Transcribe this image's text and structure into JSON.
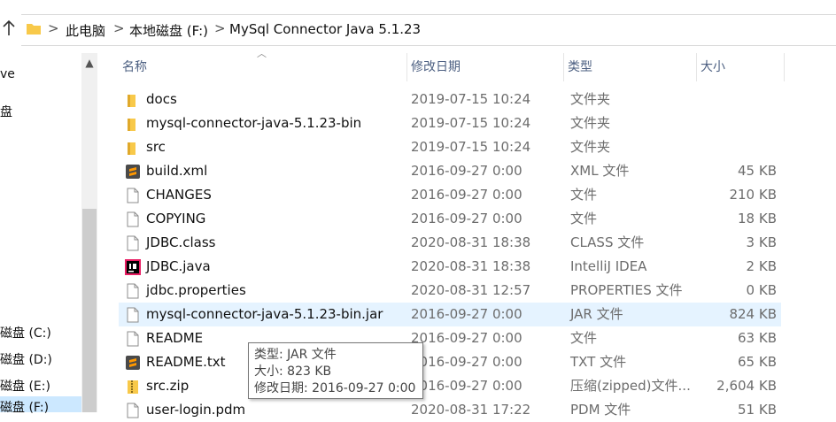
{
  "address_bar": {
    "breadcrumbs": [
      "此电脑",
      "本地磁盘 (F:)",
      "MySql Connector Java 5.1.23"
    ],
    "separator": ">"
  },
  "nav_pane": {
    "items": [
      "ve",
      "盘",
      "磁盘 (C:)",
      "磁盘 (D:)",
      "磁盘 (E:)",
      "磁盘 (F:)"
    ]
  },
  "columns": {
    "name": "名称",
    "date": "修改日期",
    "type": "类型",
    "size": "大小"
  },
  "files": [
    {
      "name": "docs",
      "date": "2019-07-15 10:24",
      "type": "文件夹",
      "size": "",
      "icon": "folder-icon"
    },
    {
      "name": "mysql-connector-java-5.1.23-bin",
      "date": "2019-07-15 10:24",
      "type": "文件夹",
      "size": "",
      "icon": "folder-icon"
    },
    {
      "name": "src",
      "date": "2019-07-15 10:24",
      "type": "文件夹",
      "size": "",
      "icon": "folder-icon"
    },
    {
      "name": "build.xml",
      "date": "2016-09-27 0:00",
      "type": "XML 文件",
      "size": "45 KB",
      "icon": "sublime-file-icon"
    },
    {
      "name": "CHANGES",
      "date": "2016-09-27 0:00",
      "type": "文件",
      "size": "210 KB",
      "icon": "file-icon"
    },
    {
      "name": "COPYING",
      "date": "2016-09-27 0:00",
      "type": "文件",
      "size": "18 KB",
      "icon": "file-icon"
    },
    {
      "name": "JDBC.class",
      "date": "2020-08-31 18:38",
      "type": "CLASS 文件",
      "size": "3 KB",
      "icon": "file-icon"
    },
    {
      "name": "JDBC.java",
      "date": "2020-08-31 18:38",
      "type": "IntelliJ IDEA",
      "size": "2 KB",
      "icon": "intellij-icon"
    },
    {
      "name": "jdbc.properties",
      "date": "2020-08-31 12:57",
      "type": "PROPERTIES 文件",
      "size": "0 KB",
      "icon": "file-icon"
    },
    {
      "name": "mysql-connector-java-5.1.23-bin.jar",
      "date": "2016-09-27 0:00",
      "type": "JAR 文件",
      "size": "824 KB",
      "icon": "file-icon"
    },
    {
      "name": "README",
      "date": "2016-09-27 0:00",
      "type": "文件",
      "size": "63 KB",
      "icon": "file-icon"
    },
    {
      "name": "README.txt",
      "date": "2016-09-27 0:00",
      "type": "TXT 文件",
      "size": "65 KB",
      "icon": "sublime-file-icon"
    },
    {
      "name": "src.zip",
      "date": "2016-09-27 0:00",
      "type": "压缩(zipped)文件...",
      "size": "2,604 KB",
      "icon": "zip-folder-icon"
    },
    {
      "name": "user-login.pdm",
      "date": "2020-08-31 17:22",
      "type": "PDM 文件",
      "size": "51 KB",
      "icon": "file-icon"
    }
  ],
  "selected_row": 9,
  "tooltip": {
    "type_line": "类型: JAR 文件",
    "size_line": "大小: 823 KB",
    "date_line": "修改日期: 2016-09-27 0:00"
  },
  "colors": {
    "folder": "#f8c94a",
    "selection": "#e5f3ff",
    "header_text": "#4d6082",
    "sublime": "#ef6c00"
  }
}
